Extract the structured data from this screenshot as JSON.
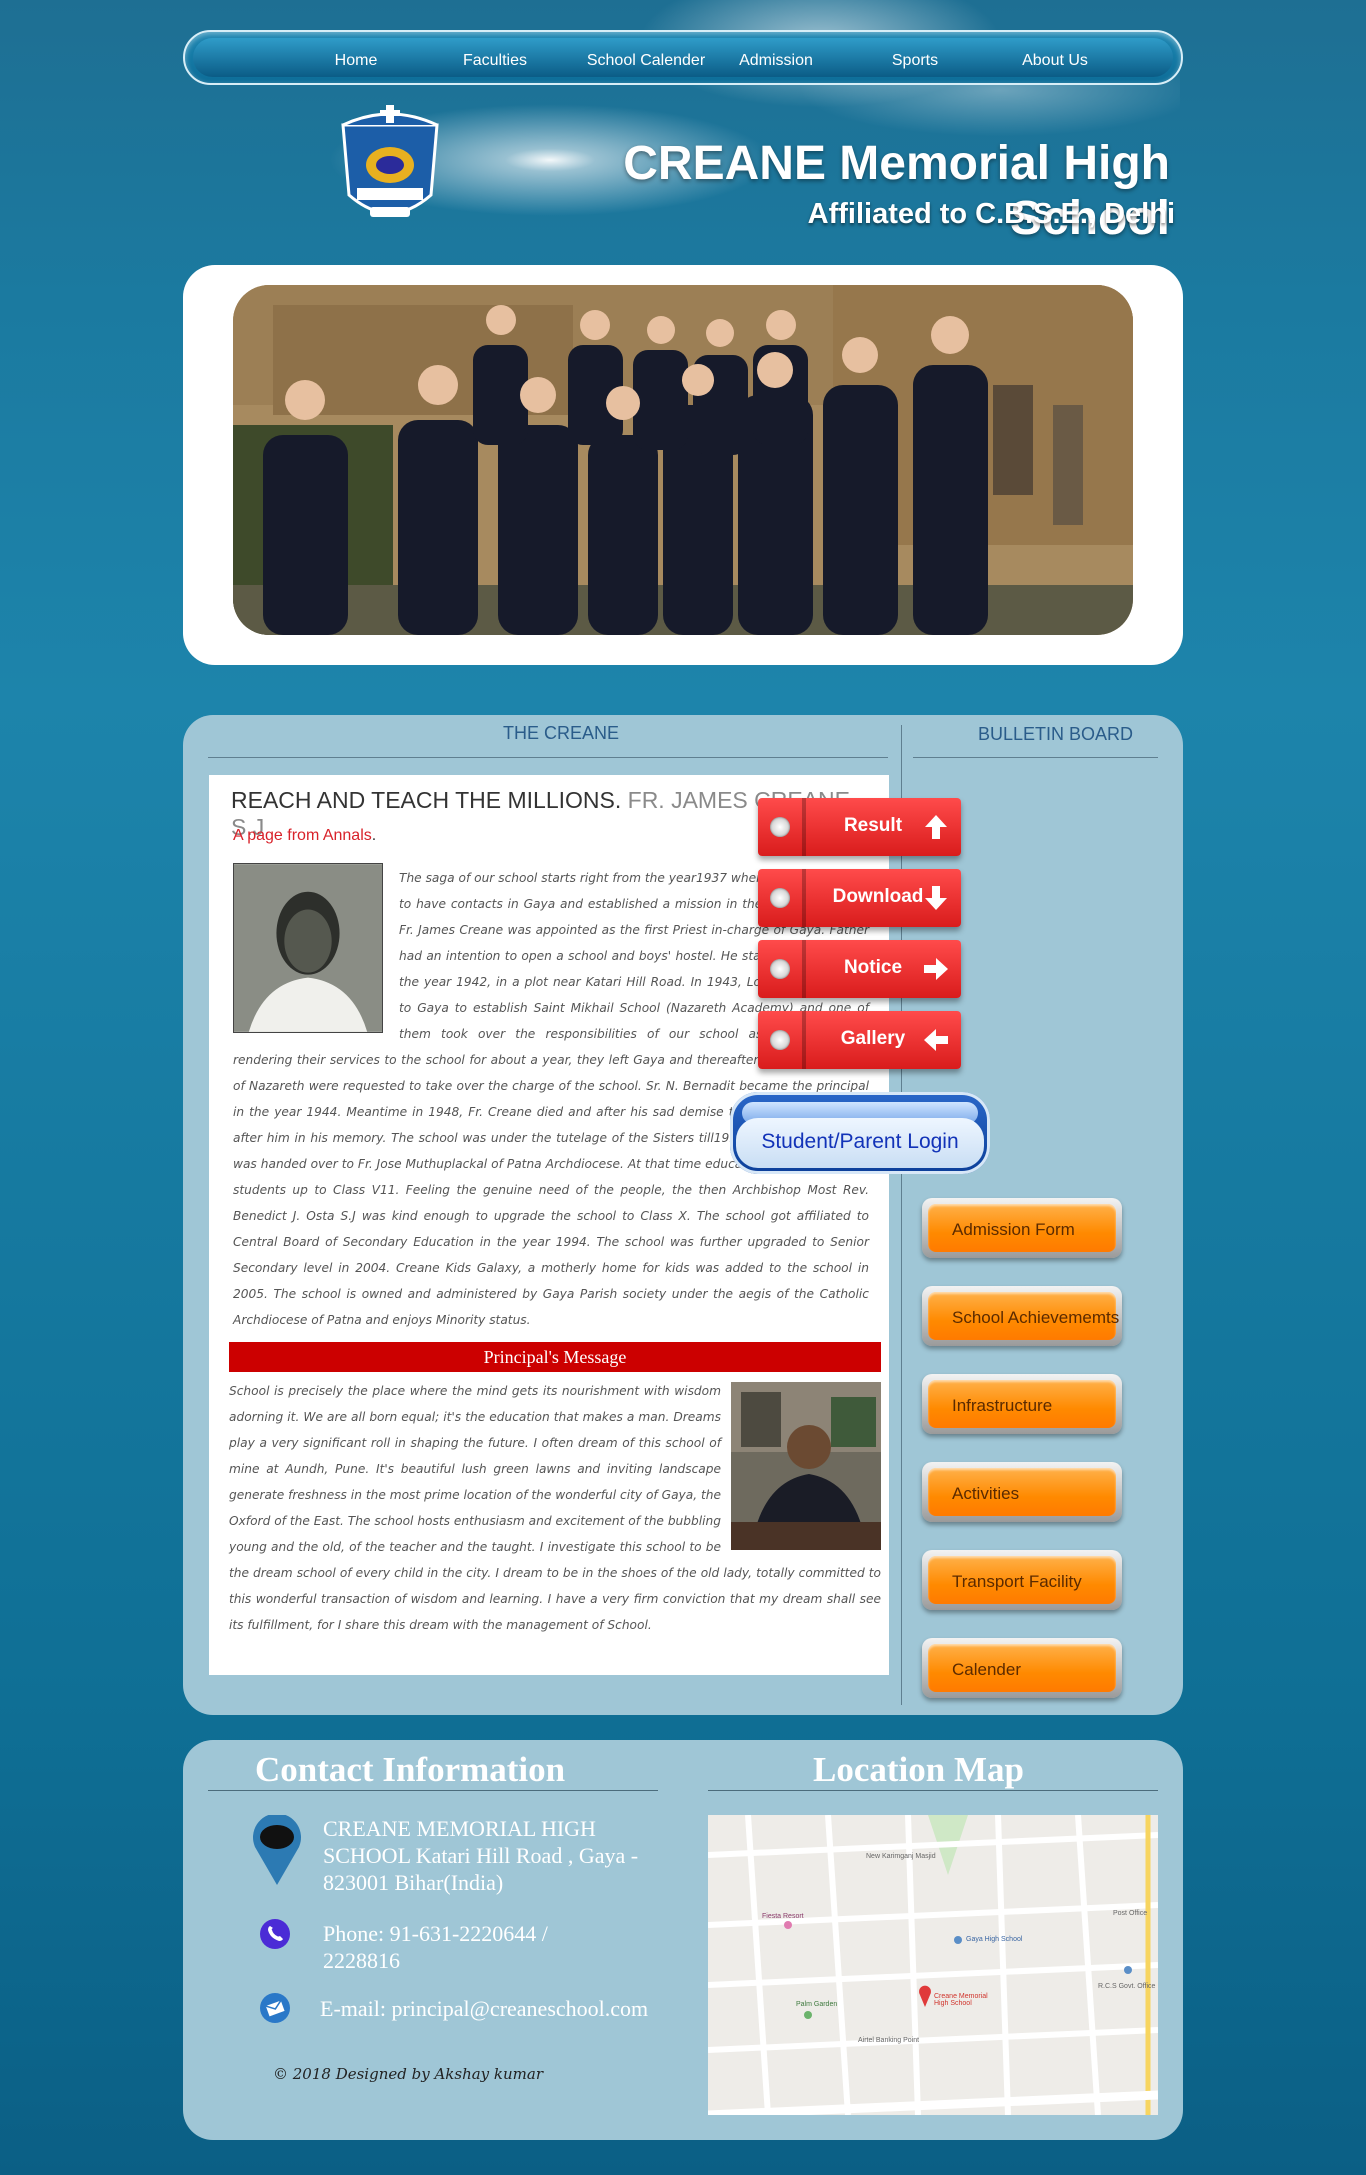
{
  "nav": {
    "items": [
      "Home",
      "Faculties",
      "School Calender",
      "Admission",
      "Sports",
      "About Us"
    ]
  },
  "header": {
    "title": "CREANE Memorial High School",
    "subtitle": "Affiliated to C.B.S.E., Delhi"
  },
  "main": {
    "left_heading": "THE CREANE",
    "right_heading": "BULLETIN BOARD",
    "article": {
      "title_main": "REACH AND TEACH THE MILLIONS.",
      "title_author": "FR. JAMES CREANE S.J",
      "annals_link": "A page from Annals",
      "annals_dot": ".",
      "history": "The saga of our school starts right from the year1937 when Fr. Lyons started to have contacts in Gaya and established a mission in the district. In 1940, Fr. James Creane was appointed as the first Priest in-charge of Gaya. Father had an intention to open a school and boys' hostel. He started the school in the year 1942, in a plot near Katari Hill Road. In 1943, Loreto sisters came to Gaya to establish Saint Mikhail School (Nazareth Academy) and one of them took over the responsibilities of our school as principal. After rendering their services to the school for about a year, they left Gaya and thereafter Sisters of Charity of Nazareth were requested to take over the charge of the school. Sr. N. Bernadit became the principal in the year 1944. Meantime in 1948, Fr. Creane died and after his sad demise the school was named after him in his memory. The school was under the tutelage of the Sisters till1990. In 1991, the baton was handed over to Fr. Jose Muthuplackal of Patna Archdiocese. At that time education was imparted to students up to Class V11. Feeling the genuine need of the people, the then Archbishop Most Rev. Benedict J. Osta S.J was kind enough to upgrade the school to Class X. The school got affiliated to Central Board of Secondary Education in the year 1994. The school was further upgraded to Senior Secondary level in 2004. Creane Kids Galaxy, a motherly home for kids was added to the school in 2005. The school is owned and administered by Gaya Parish society under the aegis of the Catholic Archdiocese of Patna and enjoys Minority status.",
      "principal_heading": "Principal's Message",
      "principal_message": "School is precisely the place where the mind gets its nourishment with wisdom adorning it. We are all born equal; it's the education that makes a man. Dreams play a very significant roll in shaping the future. I often dream of this school of mine at Aundh, Pune. It's beautiful lush green lawns and inviting landscape generate freshness in the most prime location of the wonderful city of Gaya, the Oxford of the East. The school hosts enthusiasm and excitement of the bubbling young and the old, of the teacher and the taught. I investigate this school to be the dream school of every child in the city. I dream to be in the shoes of the old lady, totally committed to this wonderful transaction of wisdom and learning. I have a very firm conviction that my dream shall see its fulfillment, for I share this dream with the management of School."
    },
    "bulletin": {
      "result": "Result",
      "download": "Download",
      "notice": "Notice",
      "gallery": "Gallery",
      "login": "Student/Parent Login",
      "links": [
        "Admission Form",
        "School Achievememts",
        "Infrastructure",
        "Activities",
        "Transport Facility",
        "Calender"
      ]
    }
  },
  "footer": {
    "contact_heading": "Contact Information",
    "map_heading": "Location Map",
    "address": "CREANE MEMORIAL HIGH SCHOOL Katari Hill Road , Gaya - 823001 Bihar(India)",
    "phone": "Phone: 91-631-2220644 / 2228816",
    "email": "E-mail: principal@creaneschool.com",
    "credit": "© 2018 Designed by Akshay kumar",
    "map_labels": {
      "marker": "Creane Memorial High School",
      "gaya_high": "Gaya High School",
      "fiesta": "Fiesta Resort",
      "palm": "Palm Garden",
      "mosque": "New Karimganj Masjid",
      "post": "Post Office",
      "rcs": "R.C.S Govt. Office",
      "airtel": "Airtel Banking Point"
    }
  },
  "colors": {
    "accent_red": "#cc0000",
    "bulletin_red": "#e82a2a",
    "orange": "#ff8a00",
    "panel": "#9fc6d6",
    "login_blue": "#1233b8"
  }
}
